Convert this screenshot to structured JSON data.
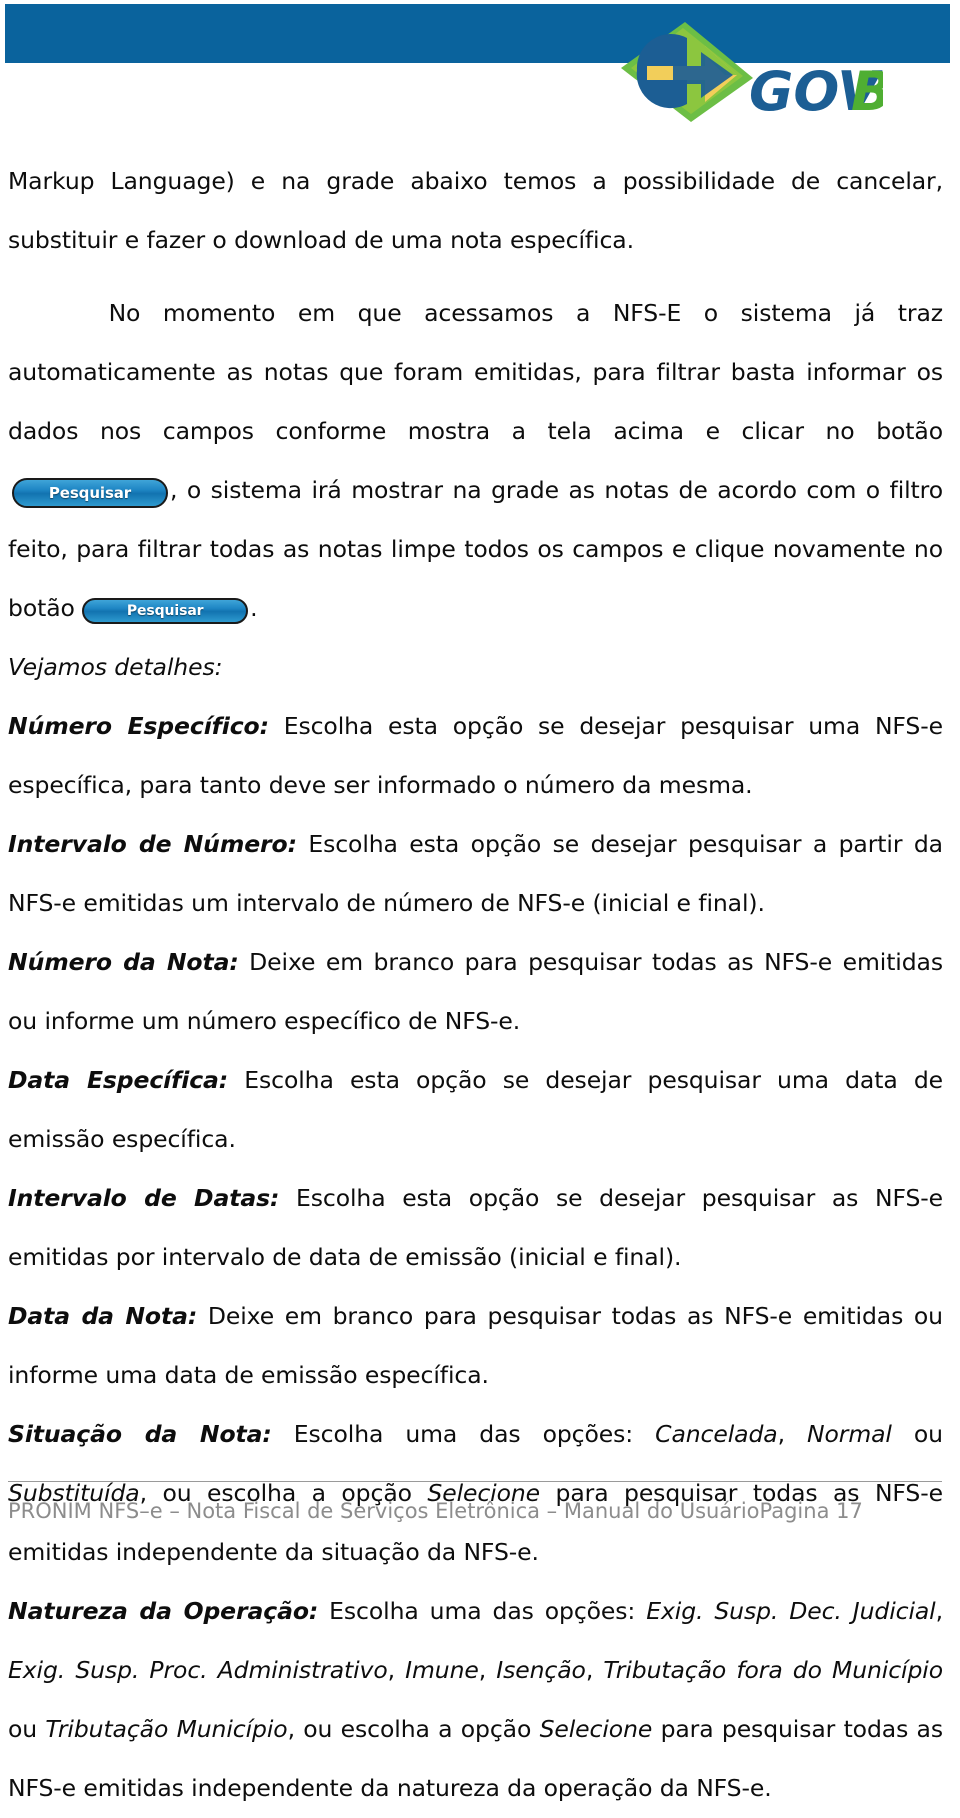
{
  "header": {
    "band_color": "#0A639D",
    "logo": {
      "name": "govbr-logo",
      "text_gov": "GOV",
      "text_br": "BR",
      "color_gov": "#1C5E94",
      "color_br": "#4FAE32",
      "color_diamond_blue": "#1C5E94",
      "color_diamond_green": "#8CC63F",
      "color_diamond_yellow": "#F2CE5A"
    }
  },
  "paragraphs": {
    "p1": "Markup Language) e na grade abaixo temos a possibilidade de cancelar, substituir e fazer o download de uma nota específica.",
    "p2_before_btn": "No momento em que acessamos a NFS-E o sistema já traz automaticamente as notas que foram emitidas, para filtrar basta informar os dados nos campos conforme mostra a tela acima e clicar no botão",
    "p2_after_btn": ", o sistema irá mostrar na grade as notas de acordo com o filtro feito, para filtrar todas as notas limpe todos os campos e clique novamente no botão",
    "p2_end": ".",
    "vejamos": "Vejamos detalhes:"
  },
  "buttons": {
    "pesquisar_label": "Pesquisar",
    "pesquisar_color": "#1E86C4"
  },
  "definitions": [
    {
      "term": "Número Específico:",
      "body": " Escolha esta opção se desejar pesquisar uma NFS-e específica, para tanto deve ser informado o número da mesma."
    },
    {
      "term": "Intervalo de Número:",
      "body": " Escolha esta opção se desejar pesquisar a partir da NFS-e emitidas um intervalo de número de NFS-e (inicial e final)."
    },
    {
      "term": "Número da Nota:",
      "body": " Deixe em branco para pesquisar todas as NFS-e emitidas ou informe um número específico de NFS-e."
    },
    {
      "term": "Data Específica:",
      "body": " Escolha esta opção se desejar pesquisar uma data de emissão específica."
    },
    {
      "term": "Intervalo de Datas:",
      "body": " Escolha esta opção se desejar pesquisar as NFS-e emitidas por intervalo de data de emissão (inicial e final)."
    },
    {
      "term": "Data da Nota:",
      "body": " Deixe em branco para pesquisar todas as NFS-e emitidas ou informe uma data de emissão específica."
    }
  ],
  "situacao": {
    "term": "Situação da Nota:",
    "seg1": " Escolha uma das opções: ",
    "opt1": "Cancelada",
    "sep1": ", ",
    "opt2": "Normal",
    "sep2": " ou ",
    "opt3": "Substituída",
    "seg2": ", ou escolha a opção ",
    "opt4": "Selecione",
    "seg3": " para pesquisar todas as NFS-e emitidas independente da situação da NFS-e."
  },
  "natureza": {
    "term": "Natureza da Operação:",
    "seg1": " Escolha uma das opções: ",
    "opt1": "Exig. Susp. Dec. Judicial",
    "sep1": ", ",
    "opt2": "Exig. Susp. Proc. Administrativo",
    "sep2": ", ",
    "opt3": "Imune",
    "sep3": ", ",
    "opt4": "Isenção",
    "sep4": ", ",
    "opt5": "Tributação fora do Município",
    "seg2": " ou ",
    "opt6": "Tributação Município",
    "seg3": ", ou escolha a opção ",
    "opt7": "Selecione",
    "seg4": " para pesquisar todas as NFS-e emitidas independente da natureza da operação da NFS-e."
  },
  "footer": {
    "left": "PRONIM NFS–e – Nota Fiscal de Serviços Eletrônica – Manual do Usuário",
    "right": "Pagina 17",
    "text_color": "#8c8c8c"
  }
}
